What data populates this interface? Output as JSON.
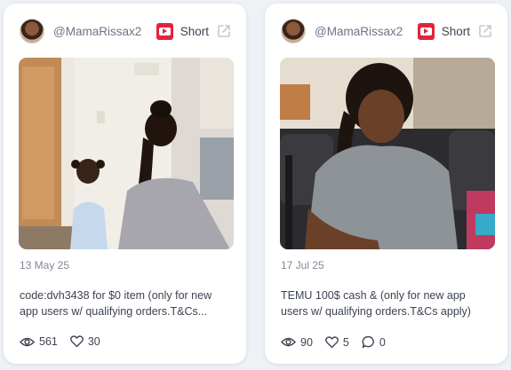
{
  "cards": [
    {
      "handle": "@MamaRissax2",
      "platform_label": "Short",
      "date": "13 May 25",
      "description": "code:dvh3438 for $0 item (only for new app users w/ qualifying orders.T&Cs...",
      "views": "561",
      "likes": "30"
    },
    {
      "handle": "@MamaRissax2",
      "platform_label": "Short",
      "date": "17 Jul 25",
      "description": "TEMU 100$ cash & (only for new app users w/ qualifying orders.T&Cs apply)",
      "views": "90",
      "likes": "5",
      "comments": "0"
    }
  ],
  "colors": {
    "youtube_red": "#e4233b",
    "card_bg": "#ffffff",
    "page_bg": "#eef1f5"
  },
  "icons": [
    "youtube-icon",
    "external-link-icon",
    "eye-icon",
    "heart-icon",
    "comment-icon"
  ]
}
